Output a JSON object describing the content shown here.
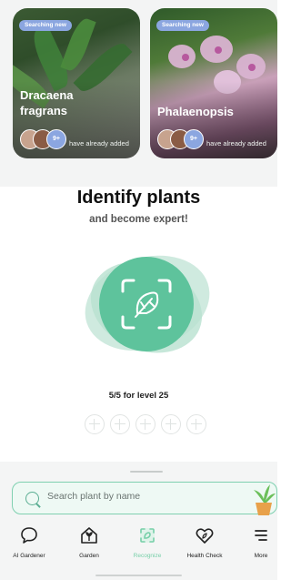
{
  "cards": [
    {
      "badge": "Searching new",
      "title_line1": "Dracaena",
      "title_line2": "fragrans",
      "plus": "9+",
      "added_text": "have already added"
    },
    {
      "badge": "Searching new",
      "title_line1": "Phalaenopsis",
      "plus": "9+",
      "added_text": "have already added"
    }
  ],
  "headline": "Identify plants",
  "subline": "and become expert!",
  "level_text": "5/5 for level 25",
  "search": {
    "placeholder": "Search plant by name"
  },
  "nav": [
    {
      "label": "AI Gardener",
      "icon": "chat-bubble-icon"
    },
    {
      "label": "Garden",
      "icon": "plant-house-icon"
    },
    {
      "label": "Recognize",
      "icon": "scan-leaf-icon",
      "active": true
    },
    {
      "label": "Health Check",
      "icon": "heart-leaf-icon"
    },
    {
      "label": "More",
      "icon": "menu-icon"
    }
  ],
  "colors": {
    "accent": "#5ec39c",
    "badge": "#8ba6e0",
    "active_tab": "#76cfa8"
  }
}
